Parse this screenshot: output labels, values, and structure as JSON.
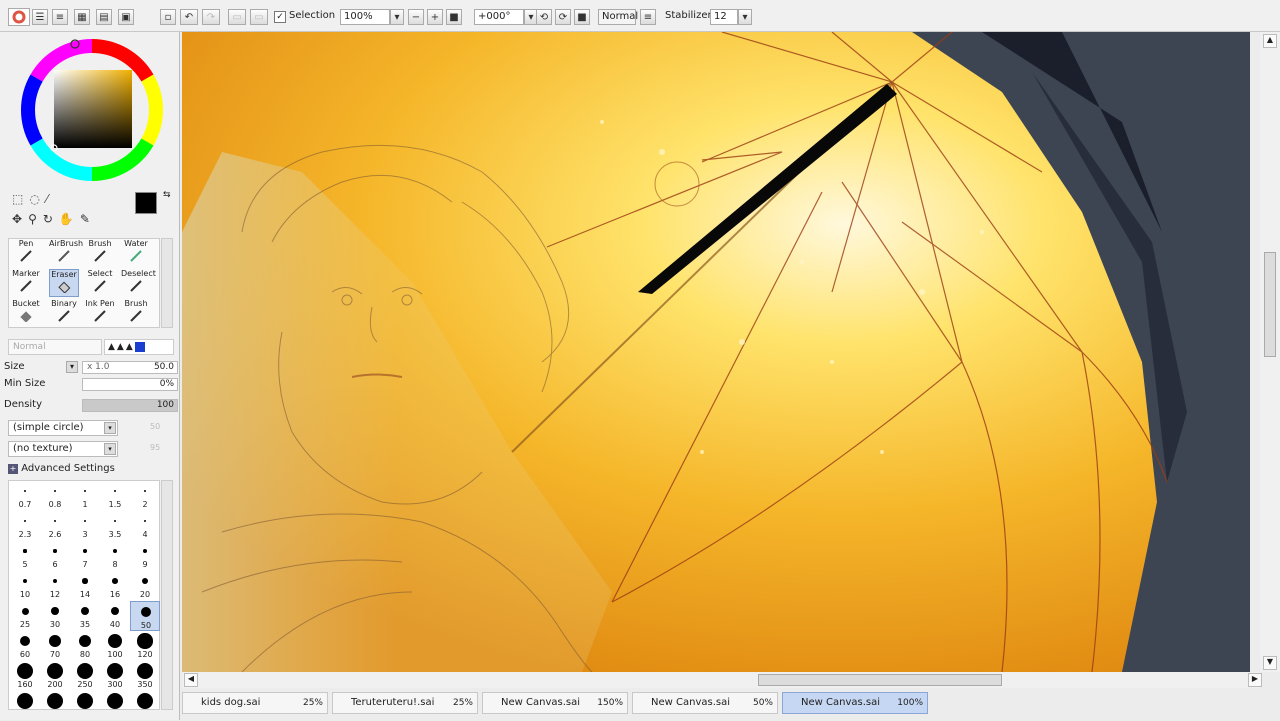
{
  "toolbar": {
    "selection_label": "Selection",
    "zoom_value": "100%",
    "angle_value": "+000°",
    "blend_mode": "Normal",
    "stabilizer_label": "Stabilizer",
    "stabilizer_value": "12"
  },
  "tools": {
    "row1": [
      "Pen",
      "AirBrush",
      "Brush",
      "Water"
    ],
    "row2": [
      "Marker",
      "Eraser",
      "Select",
      "Deselect"
    ],
    "row3": [
      "Bucket",
      "Binary",
      "Ink Pen",
      "Brush"
    ],
    "selected": "Eraser"
  },
  "brush": {
    "mode": "Normal",
    "size_label": "Size",
    "size_multiplier": "x 1.0",
    "size_value": "50.0",
    "min_size_label": "Min Size",
    "min_size_value": "0%",
    "density_label": "Density",
    "density_value": "100",
    "shape": "(simple circle)",
    "shape_value": "50",
    "texture": "(no texture)",
    "texture_value": "95",
    "advanced_label": "Advanced Settings"
  },
  "brush_sizes": [
    [
      "0.7",
      "0.8",
      "1",
      "1.5",
      "2"
    ],
    [
      "2.3",
      "2.6",
      "3",
      "3.5",
      "4"
    ],
    [
      "5",
      "6",
      "7",
      "8",
      "9"
    ],
    [
      "10",
      "12",
      "14",
      "16",
      "20"
    ],
    [
      "25",
      "30",
      "35",
      "40",
      "50"
    ],
    [
      "60",
      "70",
      "80",
      "100",
      "120"
    ],
    [
      "160",
      "200",
      "250",
      "300",
      "350"
    ],
    [
      "",
      "",
      "",
      "",
      ""
    ]
  ],
  "selected_brush_size": "50",
  "tabs": [
    {
      "name": "kids dog.sai",
      "zoom": "25%",
      "active": false
    },
    {
      "name": "Teruteruteru!.sai",
      "zoom": "25%",
      "active": false
    },
    {
      "name": "New Canvas.sai",
      "zoom": "150%",
      "active": false
    },
    {
      "name": "New Canvas.sai",
      "zoom": "50%",
      "active": false
    },
    {
      "name": "New Canvas.sai",
      "zoom": "100%",
      "active": true
    }
  ],
  "colors": {
    "primary": "#000000",
    "secondary": "#ffffff",
    "accent": "#f2b72c",
    "selected_tab": "#c6d7f3"
  }
}
